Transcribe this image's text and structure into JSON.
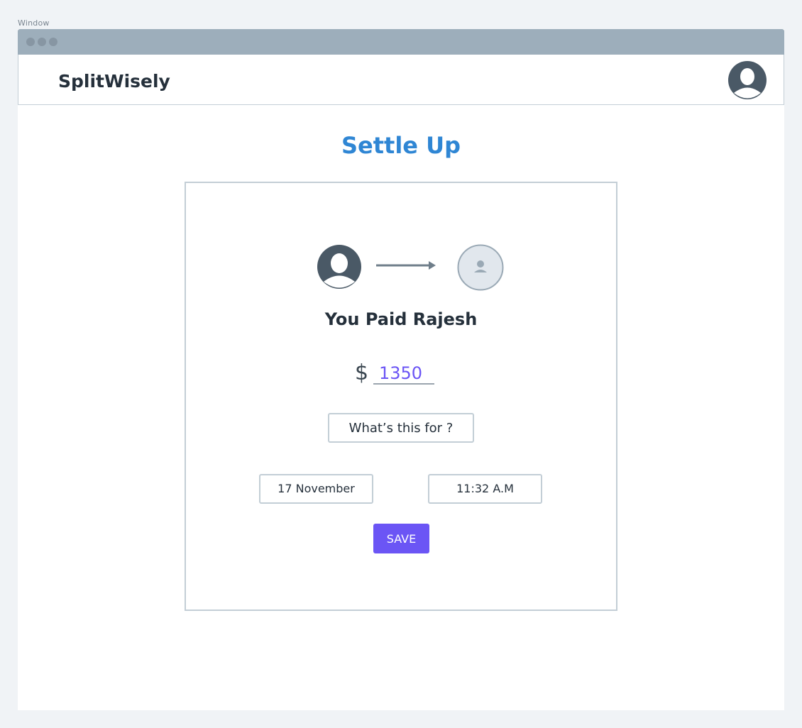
{
  "window": {
    "caption": "Window"
  },
  "header": {
    "brand": "SplitWisely"
  },
  "main": {
    "title": "Settle Up",
    "paid_text": "You Paid Rajesh",
    "currency_symbol": "$",
    "amount": "1350",
    "description_placeholder": "What’s this for ?",
    "date": "17 November",
    "time": "11:32 A.M",
    "save_label": "SAVE"
  },
  "colors": {
    "title_blue": "#2f86d4",
    "accent_purple": "#6b55f5",
    "avatar_dark": "#4a5966",
    "titlebar": "#9daebb"
  },
  "icons": {
    "profile": "user-avatar-icon",
    "payer": "user-avatar-icon",
    "arrow": "arrow-right-icon",
    "payee": "user-placeholder-icon"
  }
}
